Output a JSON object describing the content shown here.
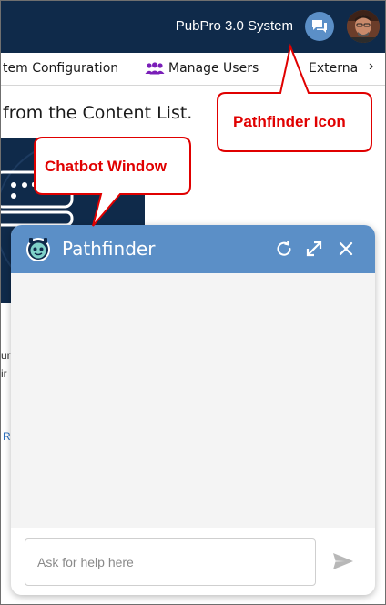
{
  "header": {
    "system_name": "PubPro 3.0 System",
    "pathfinder_icon": "chat-bubbles-icon",
    "avatar": "user-avatar",
    "background_color": "#0f2a4a"
  },
  "nav": {
    "items": [
      {
        "label": "tem Configuration"
      },
      {
        "label": "Manage Users",
        "icon": "users-icon",
        "icon_color": "#7a1fb8"
      },
      {
        "label": "Externa"
      }
    ],
    "overflow_arrow": "›"
  },
  "content": {
    "heading": "from the Content List.",
    "fragments": [
      "ur",
      "ir",
      "R"
    ]
  },
  "chatbot": {
    "title": "Pathfinder",
    "header_color": "#5b8fc7",
    "input_placeholder": "Ask for help here",
    "buttons": {
      "refresh": "refresh-icon",
      "expand": "expand-icon",
      "close": "close-icon",
      "send": "send-icon"
    }
  },
  "annotations": {
    "pathfinder_label": "Pathfinder Icon",
    "chatbot_label": "Chatbot Window",
    "color": "#e00000"
  }
}
